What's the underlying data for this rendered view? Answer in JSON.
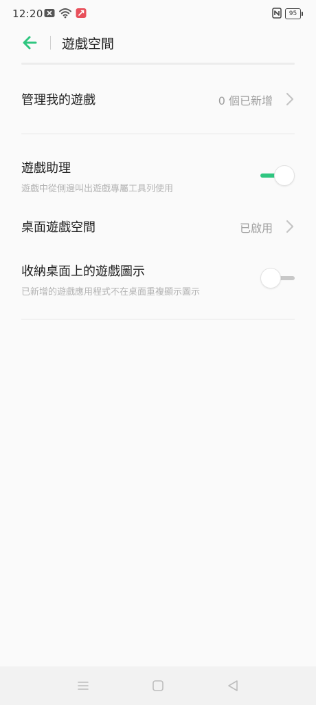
{
  "status_bar": {
    "time": "12:20",
    "battery": "95",
    "icons": [
      "notification-x-icon",
      "wifi-icon",
      "app-notification-icon",
      "nfc-icon",
      "battery-icon"
    ]
  },
  "header": {
    "title": "遊戲空間",
    "back_icon": "arrow-left-icon",
    "accent_color": "#2fc680"
  },
  "items": {
    "manage": {
      "title": "管理我的遊戲",
      "value": "0 個已新增"
    },
    "assistant": {
      "title": "遊戲助理",
      "subtitle": "遊戲中從側邊叫出遊戲專屬工具列使用",
      "enabled": true
    },
    "desktop": {
      "title": "桌面遊戲空間",
      "value": "已啟用"
    },
    "hide_icons": {
      "title": "收納桌面上的遊戲圖示",
      "subtitle": "已新增的遊戲應用程式不在桌面重複顯示圖示",
      "enabled": false
    }
  },
  "nav_bar": {
    "icons": [
      "menu-icon",
      "home-square-icon",
      "back-triangle-icon"
    ]
  }
}
